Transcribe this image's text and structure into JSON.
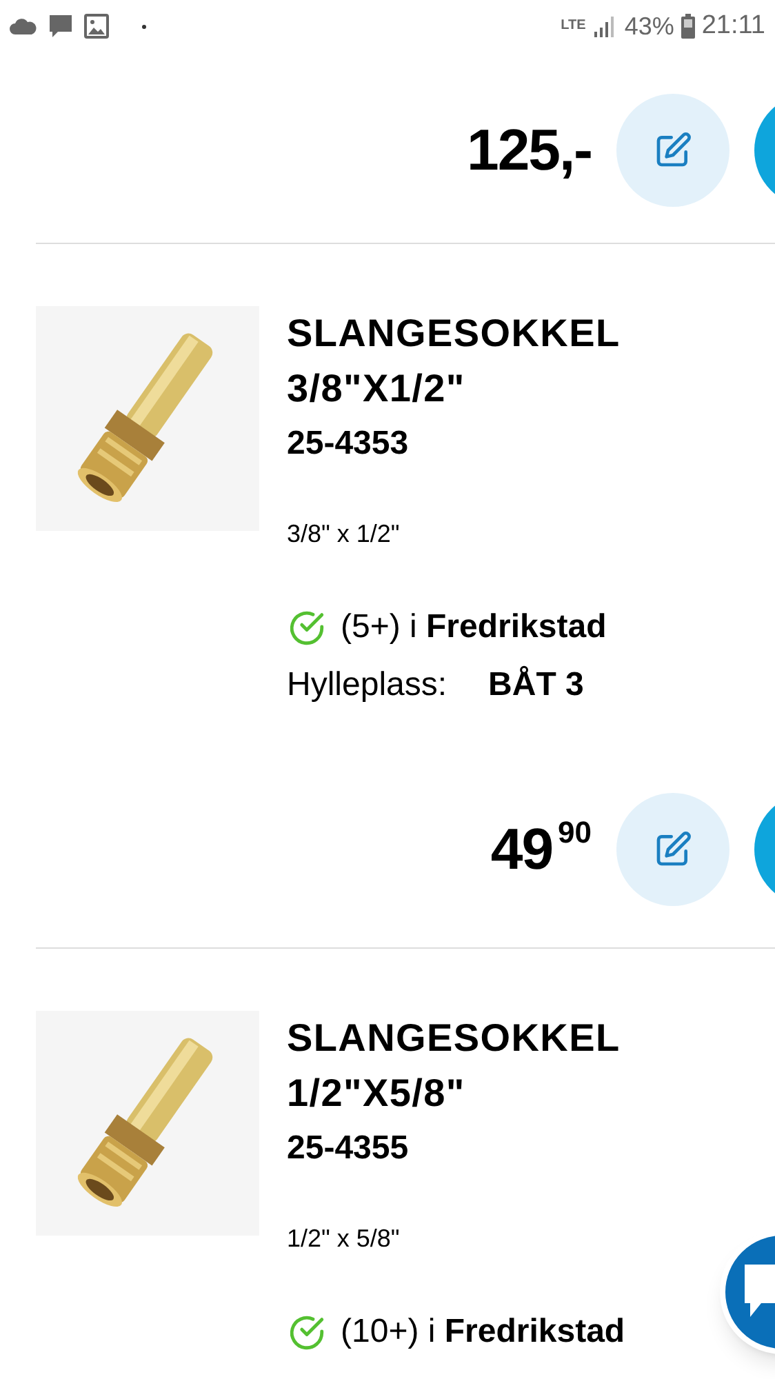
{
  "status_bar": {
    "network": "LTE",
    "battery": "43%",
    "time": "21:11"
  },
  "top_price": {
    "main": "125,-"
  },
  "products": [
    {
      "kind": "product",
      "title": "SLANGESOKKEL 3/8\"X1/2\"",
      "code": "25-4353",
      "spec": "3/8\" x 1/2\"",
      "stock": "(5+) i **Fredrikstad**",
      "in_stock": true,
      "shelf_label": "Hylleplass:",
      "shelf_value": "BÅT 3",
      "price": {
        "main": "49",
        "decimals": "90"
      }
    },
    {
      "kind": "product",
      "title": "SLANGESOKKEL 1/2\"X5/8\"",
      "code": "25-4355",
      "spec": "1/2\" x 5/8\"",
      "stock": "(10+) i **Fredrikstad**",
      "in_stock": true
    }
  ]
}
